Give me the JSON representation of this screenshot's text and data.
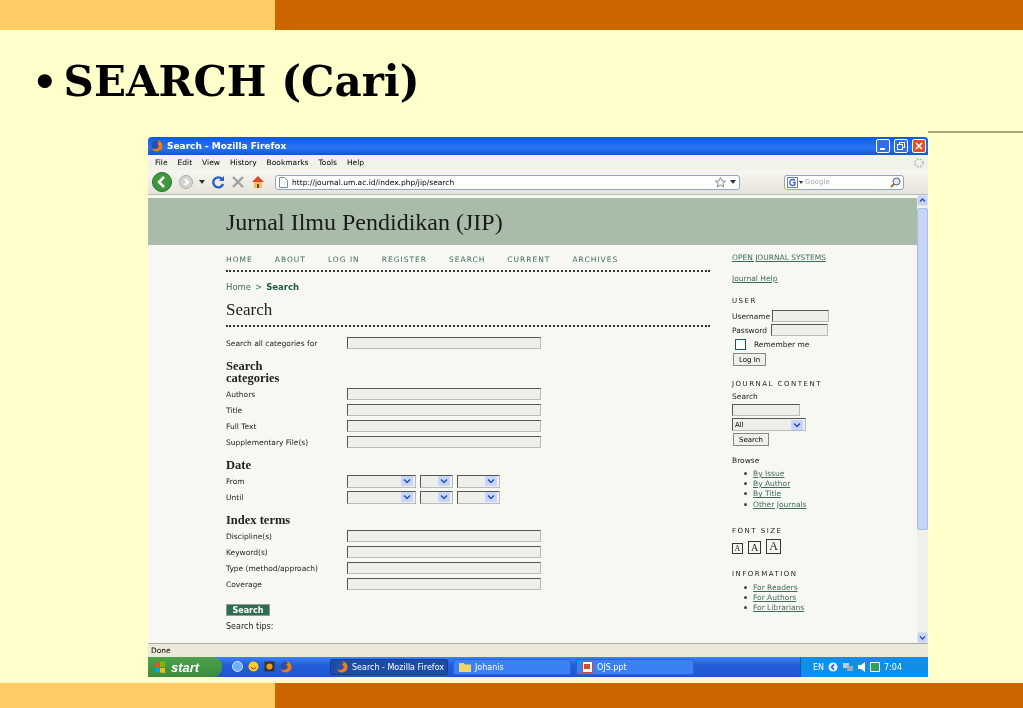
{
  "slide": {
    "bullet": "•",
    "heading": "SEARCH (Cari)"
  },
  "window": {
    "title": "Search - Mozilla Firefox"
  },
  "menu": [
    "File",
    "Edit",
    "View",
    "History",
    "Bookmarks",
    "Tools",
    "Help"
  ],
  "address_bar": {
    "url": "http://journal.um.ac.id/index.php/jip/search"
  },
  "web_search": {
    "placeholder": "Google"
  },
  "page": {
    "journal_title": "Jurnal Ilmu Pendidikan (JIP)",
    "nav": [
      "HOME",
      "ABOUT",
      "LOG IN",
      "REGISTER",
      "SEARCH",
      "CURRENT",
      "ARCHIVES"
    ],
    "breadcrumb": [
      {
        "label": "Home",
        "current": false
      },
      {
        "label": "Search",
        "current": true
      }
    ],
    "breadcrumb_separator": ">",
    "heading": "Search",
    "search_all": {
      "label": "Search all categories for"
    },
    "sections": [
      {
        "title": "Search categories",
        "fields": [
          {
            "label": "Authors",
            "kind": "text"
          },
          {
            "label": "Title",
            "kind": "text"
          },
          {
            "label": "Full Text",
            "kind": "text"
          },
          {
            "label": "Supplementary File(s)",
            "kind": "text"
          }
        ]
      },
      {
        "title": "Date",
        "fields": [
          {
            "label": "From",
            "kind": "date"
          },
          {
            "label": "Until",
            "kind": "date"
          }
        ]
      },
      {
        "title": "Index terms",
        "fields": [
          {
            "label": "Discipline(s)",
            "kind": "text"
          },
          {
            "label": "Keyword(s)",
            "kind": "text"
          },
          {
            "label": "Type (method/approach)",
            "kind": "text"
          },
          {
            "label": "Coverage",
            "kind": "text"
          }
        ]
      }
    ],
    "search_button": "Search",
    "search_tips": "Search tips:"
  },
  "sidebar": {
    "links": [
      "OPEN JOURNAL SYSTEMS",
      "Journal Help"
    ],
    "user": {
      "title": "USER",
      "username_label": "Username",
      "password_label": "Password",
      "remember_label": "Remember me",
      "remember_checked": false,
      "login_button": "Log In"
    },
    "journal_content": {
      "title": "JOURNAL CONTENT",
      "search_label": "Search",
      "scope": "All",
      "search_button": "Search",
      "browse_label": "Browse",
      "browse": [
        "By Issue",
        "By Author",
        "By Title",
        "Other Journals"
      ]
    },
    "font_size": {
      "title": "FONT SIZE",
      "buttons": [
        {
          "label": "A",
          "kind": "small"
        },
        {
          "label": "A",
          "kind": "medium"
        },
        {
          "label": "A",
          "kind": "large"
        }
      ]
    },
    "information": {
      "title": "INFORMATION",
      "links": [
        "For Readers",
        "For Authors",
        "For Librarians"
      ]
    }
  },
  "status_bar": "Done",
  "taskbar": {
    "start": "start",
    "tasks": [
      {
        "label": "Search - Mozilla Firefox",
        "kind": "browser",
        "selected": true
      },
      {
        "label": "Johanis",
        "kind": "folder",
        "selected": false
      },
      {
        "label": "OJS.ppt",
        "kind": "slides",
        "selected": false
      }
    ],
    "language": "EN",
    "clock": "7:04"
  }
}
